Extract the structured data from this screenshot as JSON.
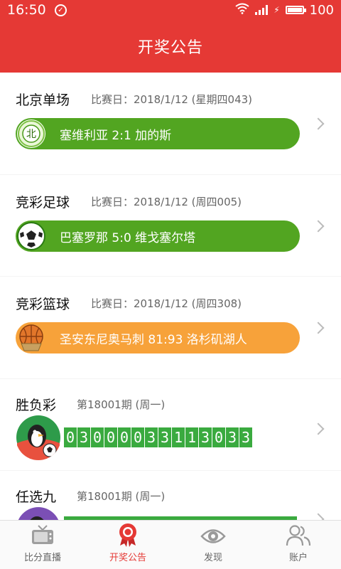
{
  "status_bar": {
    "time": "16:50",
    "battery": "100",
    "battery_level": 1.0
  },
  "header": {
    "title": "开奖公告"
  },
  "results": [
    {
      "name": "北京单场",
      "date_text": "比赛日：2018/1/12 (星期四043)",
      "match": "塞维利亚  2:1  加的斯",
      "style": "green",
      "icon": "beidan-badge-icon",
      "badge_text": "北"
    },
    {
      "name": "竞彩足球",
      "date_text": "比赛日：2018/1/12 (周四005)",
      "match": "巴塞罗那  5:0  维戈塞尔塔",
      "style": "green",
      "icon": "soccer-ball-icon"
    },
    {
      "name": "竞彩篮球",
      "date_text": "比赛日：2018/1/12 (周四308)",
      "match": "圣安东尼奥马刺  81:93  洛杉矶湖人",
      "style": "orange",
      "icon": "basketball-icon"
    }
  ],
  "lotteries": [
    {
      "name": "胜负彩",
      "period": "第18001期 (周一)",
      "numbers": [
        "0",
        "3",
        "0",
        "0",
        "0",
        "0",
        "3",
        "3",
        "1",
        "1",
        "3",
        "0",
        "3",
        "3"
      ],
      "icon": "penguin-soccer-icon"
    },
    {
      "name": "任选九",
      "period": "第18001期 (周一)",
      "numbers": [],
      "icon": "penguin-purple-icon"
    }
  ],
  "tabs": [
    {
      "label": "比分直播",
      "icon": "tv-icon",
      "active": false
    },
    {
      "label": "开奖公告",
      "icon": "award-ribbon-icon",
      "active": true
    },
    {
      "label": "发现",
      "icon": "eye-icon",
      "active": false
    },
    {
      "label": "账户",
      "icon": "users-icon",
      "active": false
    }
  ],
  "colors": {
    "brand_red": "#e53935",
    "pill_green": "#52a521",
    "pill_orange": "#f7a23a",
    "number_green": "#3aaa3f"
  }
}
